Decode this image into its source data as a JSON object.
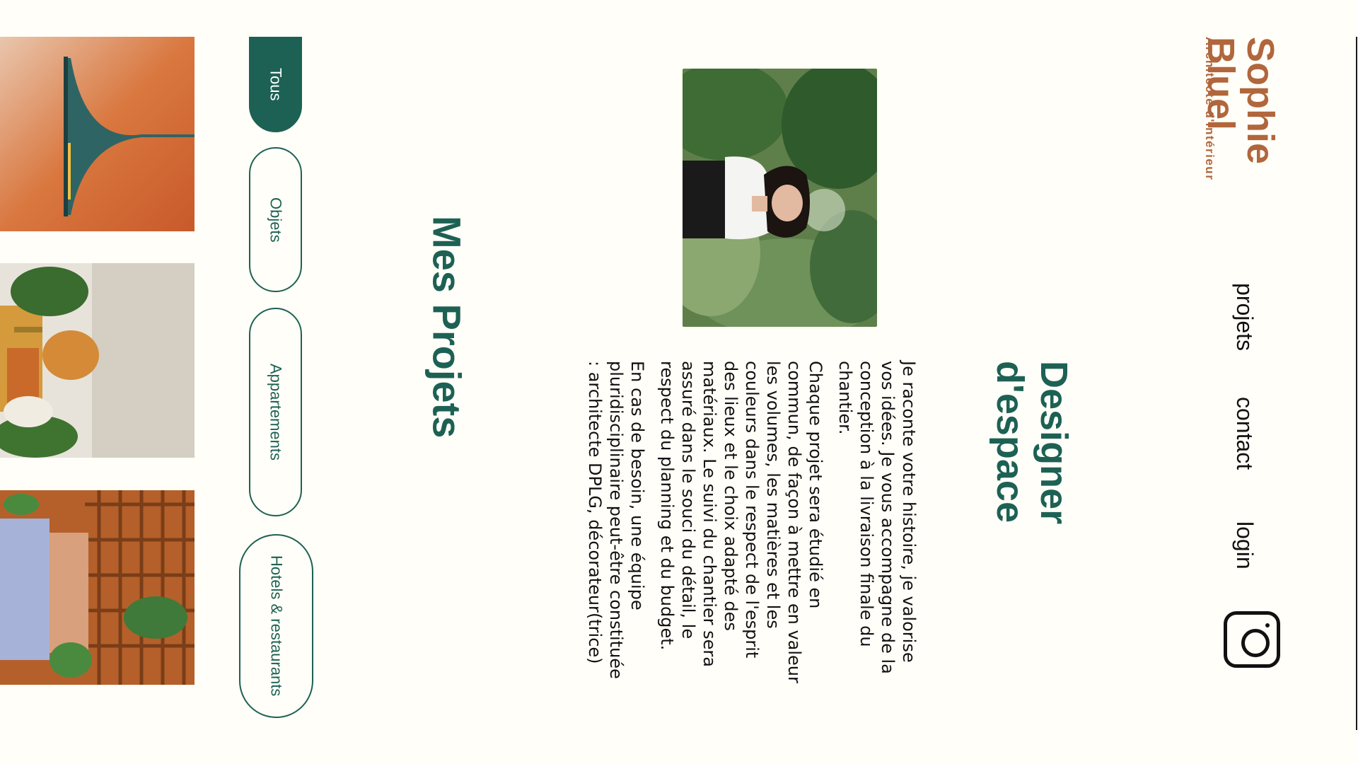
{
  "header": {
    "brand_name": "Sophie Bluel",
    "brand_tagline": "Architecte d'intérieur",
    "nav": {
      "projets": "projets",
      "contact": "contact",
      "login": "login"
    },
    "social_icon": "instagram-icon"
  },
  "introduction": {
    "title": "Designer d'espace",
    "paragraphs": [
      "Je raconte votre histoire, je valorise vos idées. Je vous accompagne de la conception à la livraison finale du chantier.",
      "Chaque projet sera étudié en commun, de façon à mettre en valeur les volumes, les matières et les couleurs dans le respect de l'esprit des lieux et le choix adapté des matériaux. Le suivi du chantier sera assuré dans le souci du détail, le respect du planning et du budget.",
      "En cas de besoin, une équipe pluridisciplinaire peut-être constituée : architecte DPLG, décorateur(trice)"
    ]
  },
  "portfolio": {
    "title": "Mes Projets",
    "filters": [
      {
        "label": "Tous",
        "active": true
      },
      {
        "label": "Objets",
        "active": false
      },
      {
        "label": "Appartements",
        "active": false
      },
      {
        "label": "Hotels & restaurants",
        "active": false
      }
    ]
  },
  "colors": {
    "brand": "#b1663c",
    "accent": "#1d6154",
    "background": "#fffef8"
  }
}
